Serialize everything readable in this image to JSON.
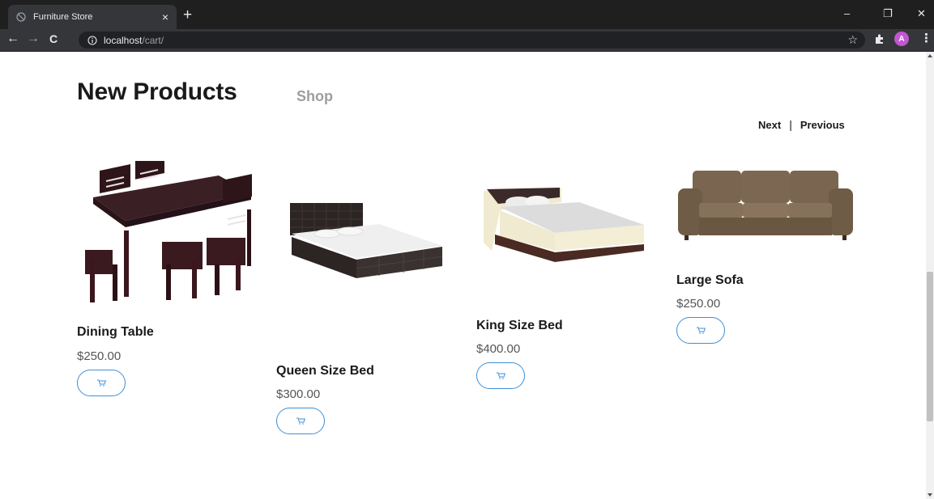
{
  "browser": {
    "tab_title": "Furniture Store",
    "tab_close": "×",
    "new_tab": "+",
    "window_controls": {
      "minimize": "–",
      "restore": "❐",
      "close": "✕"
    },
    "nav": {
      "back": "←",
      "forward": "→",
      "reload": "C"
    },
    "url_host": "localhost",
    "url_path": "/cart/",
    "star": "☆",
    "avatar_letter": "A",
    "menu": "⋮"
  },
  "page": {
    "heading": "New Products",
    "shop_link": "Shop",
    "pager": {
      "next": "Next",
      "separator": "|",
      "previous": "Previous"
    }
  },
  "products": [
    {
      "name": "Dining Table",
      "price": "$250.00",
      "image": "dining-table-image"
    },
    {
      "name": "Queen Size Bed",
      "price": "$300.00",
      "image": "queen-bed-image"
    },
    {
      "name": "King Size Bed",
      "price": "$400.00",
      "image": "king-bed-image"
    },
    {
      "name": "Large Sofa",
      "price": "$250.00",
      "image": "sofa-image"
    }
  ],
  "colors": {
    "accent": "#3d8fd6",
    "heading": "#1a1a1a",
    "muted": "#9e9e9e",
    "chrome": "#35363a"
  }
}
